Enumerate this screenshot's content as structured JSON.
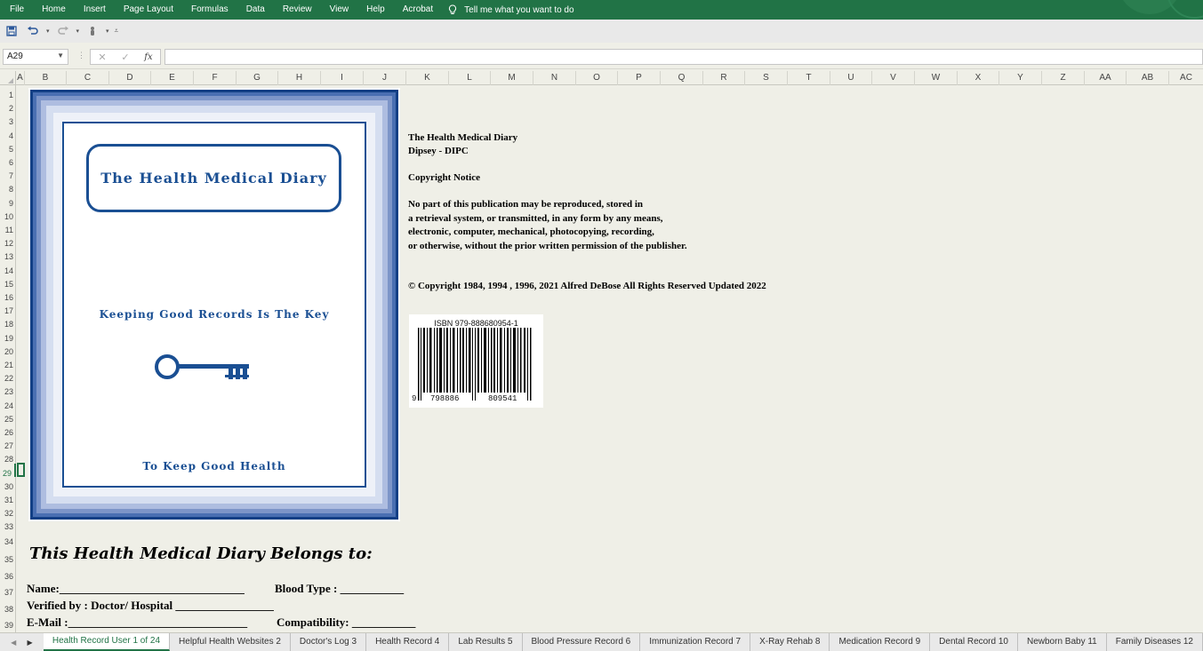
{
  "menu": {
    "items": [
      "File",
      "Home",
      "Insert",
      "Page Layout",
      "Formulas",
      "Data",
      "Review",
      "View",
      "Help",
      "Acrobat"
    ],
    "tell_me": "Tell me what you want to do",
    "tell_me_icon": "lightbulb-icon"
  },
  "quick_access": {
    "icons": [
      "save-icon",
      "undo-icon",
      "redo-icon",
      "touch-mode-icon",
      "customize-icon"
    ]
  },
  "formula_bar": {
    "name_box": "A29",
    "fx_label": "fx",
    "formula": ""
  },
  "columns": [
    "A",
    "B",
    "C",
    "D",
    "E",
    "F",
    "G",
    "H",
    "I",
    "J",
    "K",
    "L",
    "M",
    "N",
    "O",
    "P",
    "Q",
    "R",
    "S",
    "T",
    "U",
    "V",
    "W",
    "X",
    "Y",
    "Z",
    "AA",
    "AB",
    "AC"
  ],
  "rows": [
    "1",
    "2",
    "3",
    "4",
    "5",
    "6",
    "7",
    "8",
    "9",
    "10",
    "11",
    "12",
    "13",
    "14",
    "15",
    "16",
    "17",
    "18",
    "19",
    "20",
    "21",
    "22",
    "23",
    "24",
    "25",
    "26",
    "27",
    "28",
    "29",
    "30",
    "31",
    "32",
    "33",
    "34",
    "35",
    "36",
    "37",
    "38",
    "39"
  ],
  "active_row": "29",
  "cover": {
    "title": "The Health Medical Diary",
    "subtitle": "Keeping Good Records Is The Key",
    "footer": "To Keep Good Health",
    "frame_color": "#1a4f93",
    "key_icon": "key-icon"
  },
  "copyright": {
    "line1": "The Health Medical Diary",
    "line2": "Dipsey - DIPC",
    "heading": "Copyright Notice",
    "notice1": "No part of this publication may be reproduced, stored in",
    "notice2": "a retrieval system, or transmitted, in any form by any means,",
    "notice3": "electronic, computer, mechanical, photocopying, recording,",
    "notice4": "or otherwise, without the prior written permission of the publisher.",
    "rights": "© Copyright 1984, 1994 , 1996, 2021  Alfred DeBose   All Rights Reserved   Updated 2022"
  },
  "barcode": {
    "isbn": "ISBN 979-888680954-1",
    "digit_left": "9",
    "digits_mid": "798886",
    "digits_right": "809541"
  },
  "owner": {
    "heading": "This Health Medical Diary Belongs to:",
    "name_line": "Name:________________________________",
    "blood_line": "Blood Type : ___________",
    "verified_line": "Verified by : Doctor/ Hospital _________________",
    "email_line": "E-Mail :_______________________________",
    "compat_line": "Compatibility: ___________"
  },
  "sheet_tabs": [
    "Health Record User 1 of 24",
    "Helpful Health Websites 2",
    "Doctor's Log 3",
    "Health Record 4",
    "Lab Results 5",
    "Blood Pressure Record 6",
    "Immunization Record 7",
    "X-Ray Rehab 8",
    "Medication Record 9",
    "Dental Record 10",
    "Newborn Baby 11",
    "Family Diseases 12"
  ],
  "active_tab": 0,
  "colors": {
    "accent": "#217346",
    "cover_blue": "#1a4f93"
  }
}
